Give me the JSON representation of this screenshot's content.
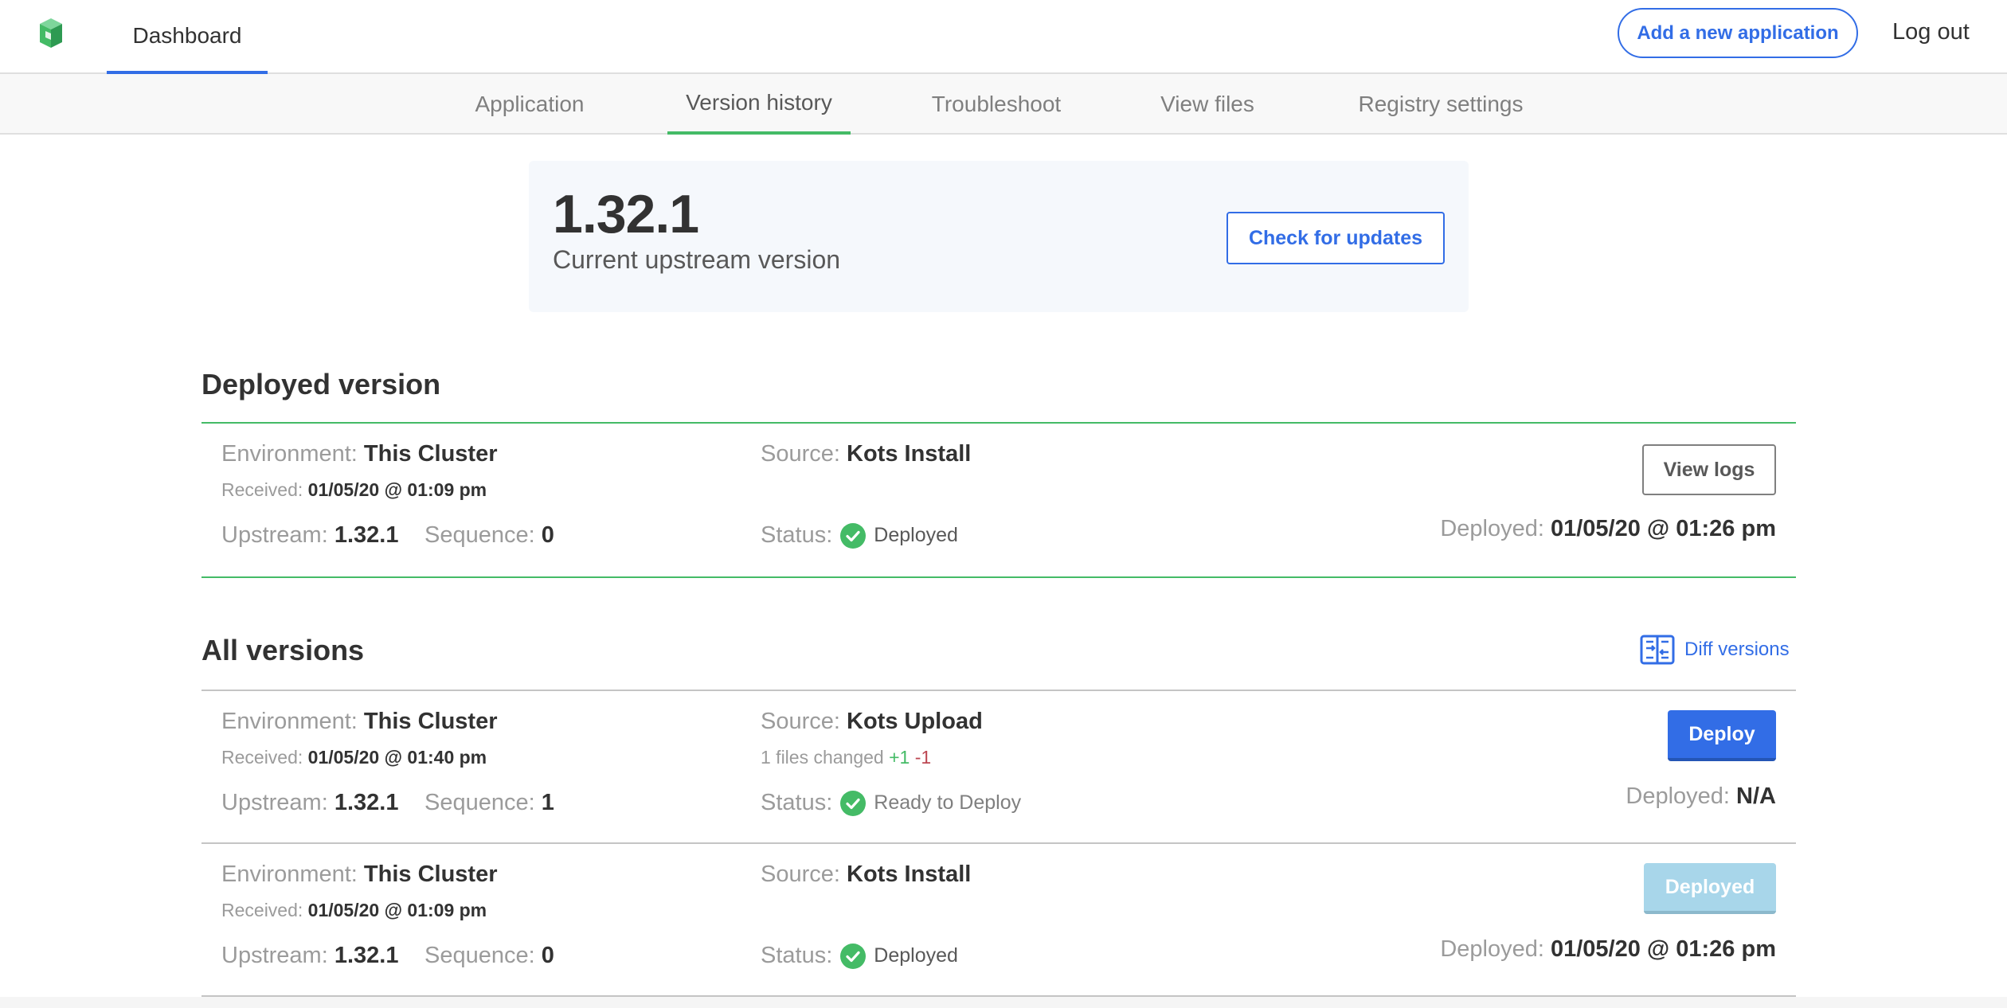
{
  "header": {
    "nav_dashboard": "Dashboard",
    "add_app_label": "Add a new application",
    "logout_label": "Log out",
    "logo_icon": "kots-logo-icon"
  },
  "subnav": {
    "tabs": [
      {
        "label": "Application",
        "active": false
      },
      {
        "label": "Version history",
        "active": true
      },
      {
        "label": "Troubleshoot",
        "active": false
      },
      {
        "label": "View files",
        "active": false
      },
      {
        "label": "Registry settings",
        "active": false
      }
    ]
  },
  "upstream": {
    "version": "1.32.1",
    "caption": "Current upstream version",
    "check_label": "Check for updates"
  },
  "deployed_section": {
    "title": "Deployed version",
    "row": {
      "environment_label": "Environment:",
      "environment": "This Cluster",
      "received_label": "Received:",
      "received": "01/05/20 @ 01:09 pm",
      "upstream_label": "Upstream:",
      "upstream": "1.32.1",
      "sequence_label": "Sequence:",
      "sequence": "0",
      "source_label": "Source:",
      "source": "Kots Install",
      "status_label": "Status:",
      "status": "Deployed",
      "deployed_label": "Deployed:",
      "deployed": "01/05/20 @ 01:26 pm",
      "action_label": "View logs"
    }
  },
  "all_versions": {
    "title": "All versions",
    "diff_label": "Diff versions",
    "rows": [
      {
        "environment_label": "Environment:",
        "environment": "This Cluster",
        "received_label": "Received:",
        "received": "01/05/20 @ 01:40 pm",
        "upstream_label": "Upstream:",
        "upstream": "1.32.1",
        "sequence_label": "Sequence:",
        "sequence": "1",
        "source_label": "Source:",
        "source": "Kots Upload",
        "files_changed": "1 files changed",
        "additions": "+1",
        "deletions": "-1",
        "status_label": "Status:",
        "status": "Ready to Deploy",
        "deployed_label": "Deployed:",
        "deployed": "N/A",
        "action_label": "Deploy"
      },
      {
        "environment_label": "Environment:",
        "environment": "This Cluster",
        "received_label": "Received:",
        "received": "01/05/20 @ 01:09 pm",
        "upstream_label": "Upstream:",
        "upstream": "1.32.1",
        "sequence_label": "Sequence:",
        "sequence": "0",
        "source_label": "Source:",
        "source": "Kots Install",
        "status_label": "Status:",
        "status": "Deployed",
        "deployed_label": "Deployed:",
        "deployed": "01/05/20 @ 01:26 pm",
        "action_label": "Deployed"
      }
    ]
  },
  "colors": {
    "accent": "#326de6",
    "success": "#44bb66",
    "danger": "#bc4752",
    "muted": "#9b9b9b"
  }
}
